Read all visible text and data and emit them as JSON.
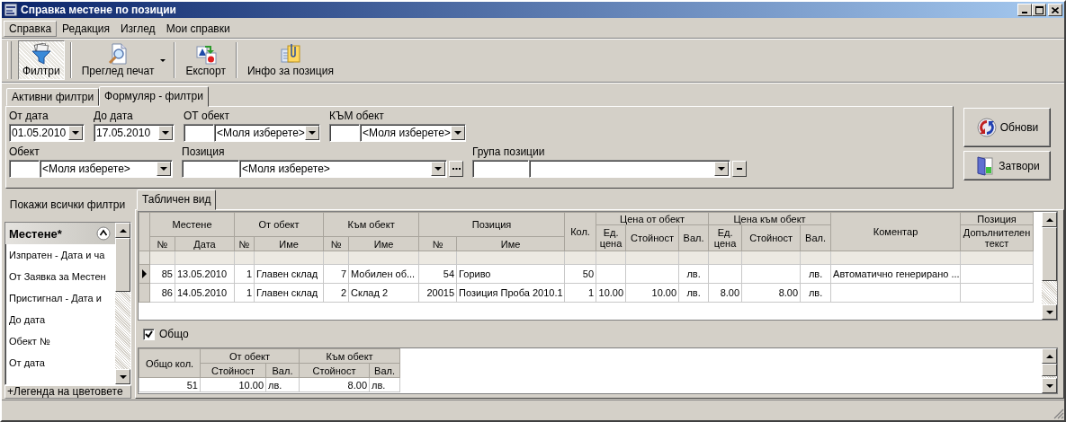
{
  "window": {
    "title": "Справка местене по позиции"
  },
  "menu": [
    {
      "label": "Справка",
      "selected": true
    },
    {
      "label": "Редакция",
      "selected": false
    },
    {
      "label": "Изглед",
      "selected": false
    },
    {
      "label": "Мои справки",
      "selected": false
    }
  ],
  "toolbar": [
    {
      "label": "Филтри",
      "kind": "filter",
      "pressed": true,
      "dropdown": false
    },
    {
      "label": "Преглед печат",
      "kind": "preview",
      "pressed": false,
      "dropdown": true
    },
    {
      "label": "Експорт",
      "kind": "export",
      "pressed": false,
      "dropdown": false
    },
    {
      "label": "Инфо за позиция",
      "kind": "info",
      "pressed": false,
      "dropdown": false
    }
  ],
  "filter_tabs": [
    {
      "label": "Активни филтри",
      "selected": false
    },
    {
      "label": "Формуляр - филтри",
      "selected": true
    }
  ],
  "filter_rows": [
    [
      {
        "label": "От дата",
        "kind": "date",
        "value": "01.05.2010"
      },
      {
        "label": "До дата",
        "kind": "date",
        "value": "17.05.2010"
      },
      {
        "label": "ОТ обект",
        "kind": "lookup",
        "value": "<Моля изберете>"
      },
      {
        "label": "КЪМ обект",
        "kind": "lookup",
        "value": "<Моля изберете>"
      }
    ],
    [
      {
        "label": "Обект",
        "kind": "lookup",
        "value": "<Моля изберете>"
      },
      {
        "label": "Позиция",
        "kind": "lookup_more",
        "value": "<Моля изберете>"
      },
      {
        "label": "Група позиции",
        "kind": "lookup_clear"
      }
    ]
  ],
  "actions": [
    {
      "label": "Обнови",
      "kind": "refresh"
    },
    {
      "label": "Затвори",
      "kind": "close"
    }
  ],
  "filter_list": {
    "toggle": "Покажи всички филтри",
    "header": "Местене*",
    "items": [
      "Изпратен - Дата и ча",
      "От Заявка за Местен",
      "Пристигнал - Дата и",
      "До дата",
      "Обект №",
      "От дата"
    ],
    "legend": "+Легенда на цветовете"
  },
  "view_tabs": [
    {
      "label": "Табличен вид",
      "selected": true
    }
  ],
  "grid": {
    "header": [
      {
        "kind": "group",
        "label": "Местене",
        "columns": [
          {
            "label": "№",
            "kind": "number"
          },
          {
            "label": "Дата",
            "kind": "text"
          }
        ]
      },
      {
        "kind": "group",
        "label": "От обект",
        "columns": [
          {
            "label": "№",
            "kind": "number"
          },
          {
            "label": "Име",
            "kind": "text"
          }
        ]
      },
      {
        "kind": "group",
        "label": "Към обект",
        "columns": [
          {
            "label": "№",
            "kind": "number"
          },
          {
            "label": "Име",
            "kind": "text"
          }
        ]
      },
      {
        "kind": "group",
        "label": "Позиция",
        "columns": [
          {
            "label": "№",
            "kind": "number"
          },
          {
            "label": "Име",
            "kind": "text"
          }
        ]
      },
      {
        "kind": "single_number",
        "label": "Кол."
      },
      {
        "kind": "split",
        "label": "Цена от обект",
        "columns": [
          {
            "label": "Ед. цена",
            "kind": "number"
          },
          {
            "label": "Стойност",
            "kind": "number"
          },
          {
            "label": "Вал.",
            "kind": "code"
          }
        ]
      },
      {
        "kind": "split",
        "label": "Цена към обект",
        "columns": [
          {
            "label": "Ед. цена",
            "kind": "number"
          },
          {
            "label": "Стойност",
            "kind": "number"
          },
          {
            "label": "Вал.",
            "kind": "code"
          }
        ]
      },
      {
        "kind": "single_text",
        "label": "Коментар"
      },
      {
        "kind": "split",
        "label": "Позиция",
        "columns": [
          {
            "label": "Допълнителен текст",
            "kind": "text"
          }
        ]
      }
    ],
    "rows": [
      {
        "selected": true,
        "cells": [
          "85",
          "13.05.2010",
          "1",
          "Главен склад",
          "7",
          "Мобилен об...",
          "54",
          "Гориво",
          "50",
          null,
          null,
          "лв.",
          null,
          null,
          "лв.",
          "Автоматично генерирано ...",
          null
        ]
      },
      {
        "selected": false,
        "cells": [
          "86",
          "14.05.2010",
          "1",
          "Главен склад",
          "2",
          "Склад 2",
          "20015",
          "Позиция Проба 2010.1",
          "1",
          "10.00",
          "10.00",
          "лв.",
          "8.00",
          "8.00",
          "лв.",
          null,
          null
        ]
      }
    ]
  },
  "total": {
    "label": "Общо",
    "checked": true
  },
  "summary": {
    "header": [
      {
        "kind": "single_number",
        "label": "Общо кол."
      },
      {
        "kind": "group",
        "label": "От обект",
        "columns": [
          {
            "label": "Стойност",
            "kind": "number"
          },
          {
            "label": "Вал.",
            "kind": "text"
          }
        ]
      },
      {
        "kind": "group",
        "label": "Към обект",
        "columns": [
          {
            "label": "Стойност",
            "kind": "number"
          },
          {
            "label": "Вал.",
            "kind": "text"
          }
        ]
      }
    ],
    "cells": [
      "51",
      "10.00",
      "лв.",
      "8.00",
      "лв."
    ]
  }
}
